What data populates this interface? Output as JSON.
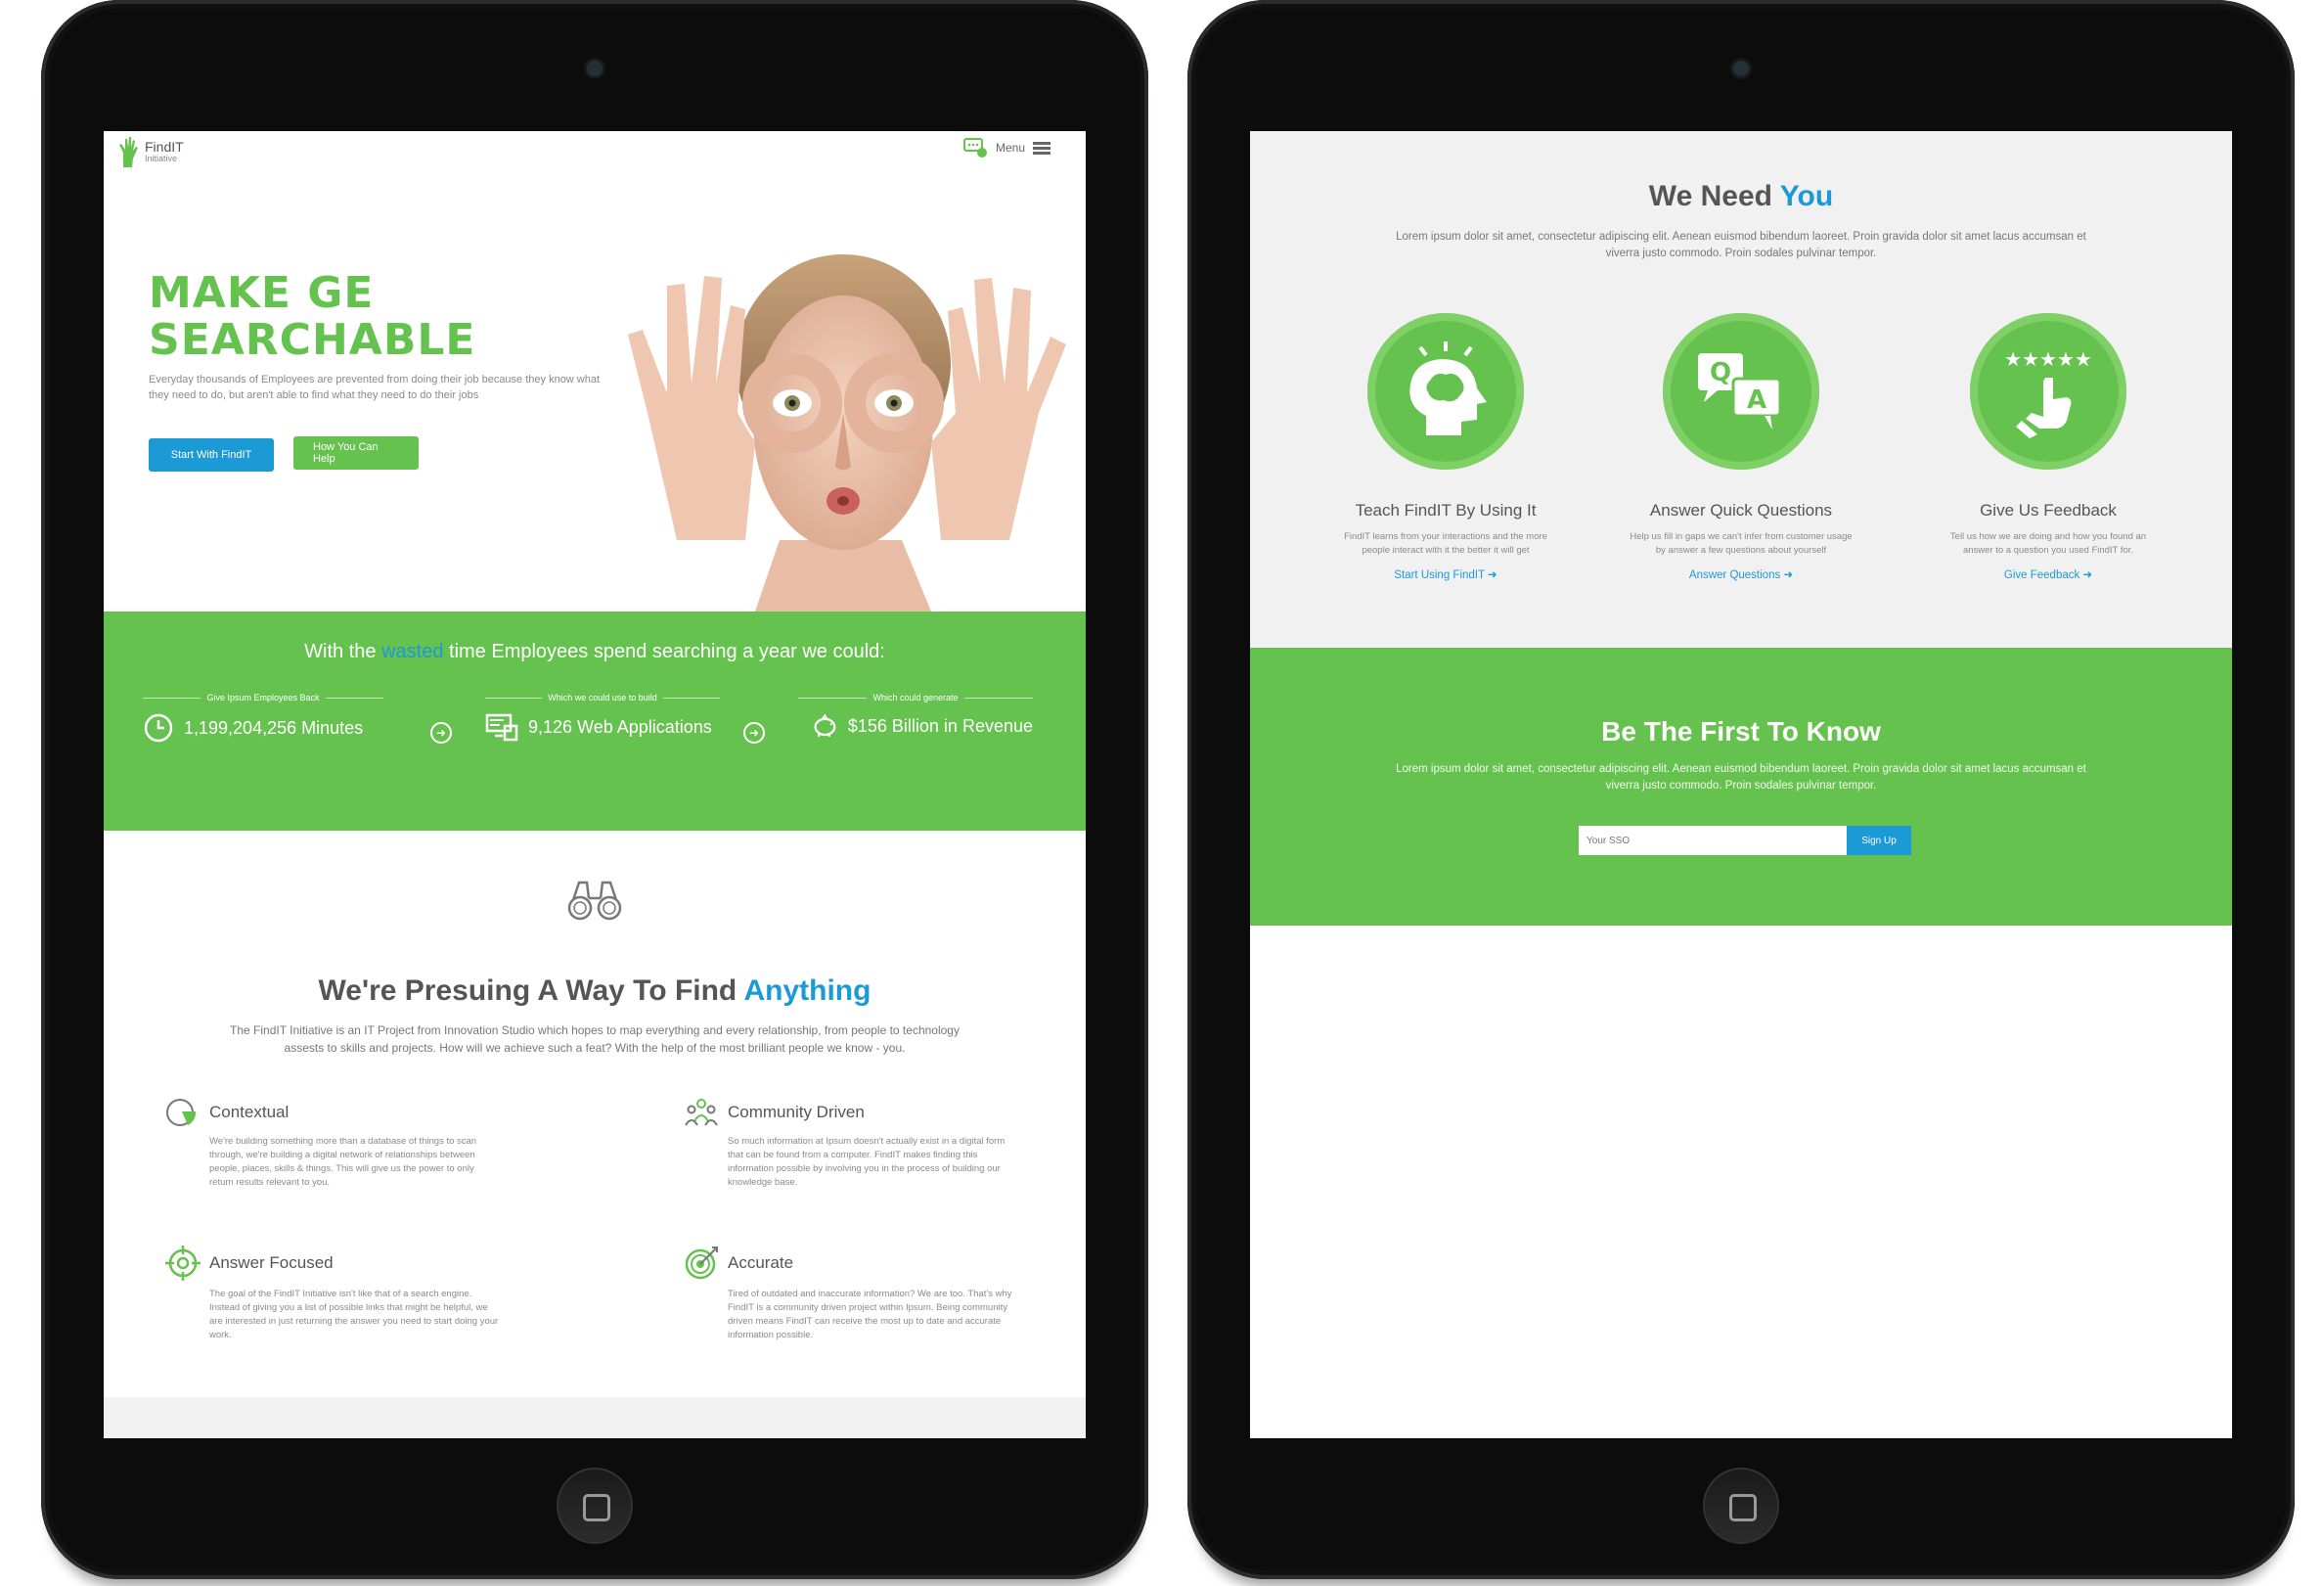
{
  "colors": {
    "brand_green": "#66c24e",
    "accent_blue": "#1c9ad6",
    "text_gray": "#555555"
  },
  "left": {
    "logo": {
      "name": "FindIT",
      "sub": "Initiative"
    },
    "menu_label": "Menu",
    "hero": {
      "title_line1": "MAKE GE",
      "title_line2": "SEARCHABLE",
      "description": "Everyday thousands of Employees are prevented from doing their job because they know what they need to do, but aren't able to find what they need to do their jobs",
      "primary_button": "Start With FindIT",
      "secondary_button": "How You Can Help"
    },
    "stats": {
      "heading_pre": "With the ",
      "heading_highlight": "wasted",
      "heading_post": " time Employees spend searching a year we could:",
      "items": [
        {
          "caption": "Give Ipsum Employees Back",
          "value": "1,199,204,256 Minutes",
          "icon": "clock-icon"
        },
        {
          "caption": "Which we could use to build",
          "value": "9,126 Web Applications",
          "icon": "computer-icon"
        },
        {
          "caption": "Which could generate",
          "value": "$156 Billion in Revenue",
          "icon": "piggy-bank-icon"
        }
      ]
    },
    "section": {
      "title_pre": "We're Presuing A Way To Find ",
      "title_highlight": "Anything",
      "intro": "The FindIT Initiative is an IT Project from Innovation Studio which hopes to map everything and every relationship, from people to technology assests to skills and projects. How will we achieve such a feat? With the help of the most brilliant people we know - you.",
      "features": [
        {
          "title": "Contextual",
          "icon": "pie-chart-icon",
          "body": "We're building something more than a database of things to scan through, we're building a digital network of relationships between people, places, skills & things. This will give us the power to only return results relevant to you."
        },
        {
          "title": "Community Driven",
          "icon": "community-icon",
          "body": "So much information at Ipsum doesn't actually exist in a digital form that can be found from a computer. FindIT makes finding this information possible by involving you in the process of building our knowledge base."
        },
        {
          "title": "Answer Focused",
          "icon": "crosshair-icon",
          "body": "The goal of the FindIT Initiative isn't like that of a search engine. Instead of giving you a list of possible links that might be helpful, we are interested in just returning the answer you need to start doing your work."
        },
        {
          "title": "Accurate",
          "icon": "target-icon",
          "body": "Tired of outdated and inaccurate information? We are too. That's why FindIT is a community driven project within Ipsum. Being community driven means FindIT can receive the most up to date and accurate information possible."
        }
      ]
    }
  },
  "right": {
    "need": {
      "title_pre": "We Need ",
      "title_highlight": "You",
      "description": "Lorem ipsum dolor sit amet, consectetur adipiscing elit. Aenean euismod bibendum laoreet. Proin gravida dolor sit amet lacus accumsan et viverra justo commodo. Proin sodales pulvinar tempor.",
      "columns": [
        {
          "title": "Teach FindIT By Using It",
          "icon": "brain-icon",
          "desc": "FindIT learns from your interactions and the more people interact with it the better it will get",
          "link": "Start Using FindIT"
        },
        {
          "title": "Answer Quick Questions",
          "icon": "qa-bubbles-icon",
          "desc": "Help us fill in gaps we can't infer from customer usage by answer a few questions about yourself",
          "link": "Answer Questions"
        },
        {
          "title": "Give Us Feedback",
          "icon": "star-rating-icon",
          "desc": "Tell us how we are doing and how you found an answer to a question you used FindIT for.",
          "link": "Give Feedback"
        }
      ]
    },
    "know": {
      "title": "Be The First To Know",
      "description": "Lorem ipsum dolor sit amet, consectetur adipiscing elit. Aenean euismod bibendum laoreet. Proin gravida dolor sit amet lacus accumsan et viverra justo commodo. Proin sodales pulvinar tempor.",
      "input_placeholder": "Your SSO",
      "button": "Sign Up"
    }
  }
}
